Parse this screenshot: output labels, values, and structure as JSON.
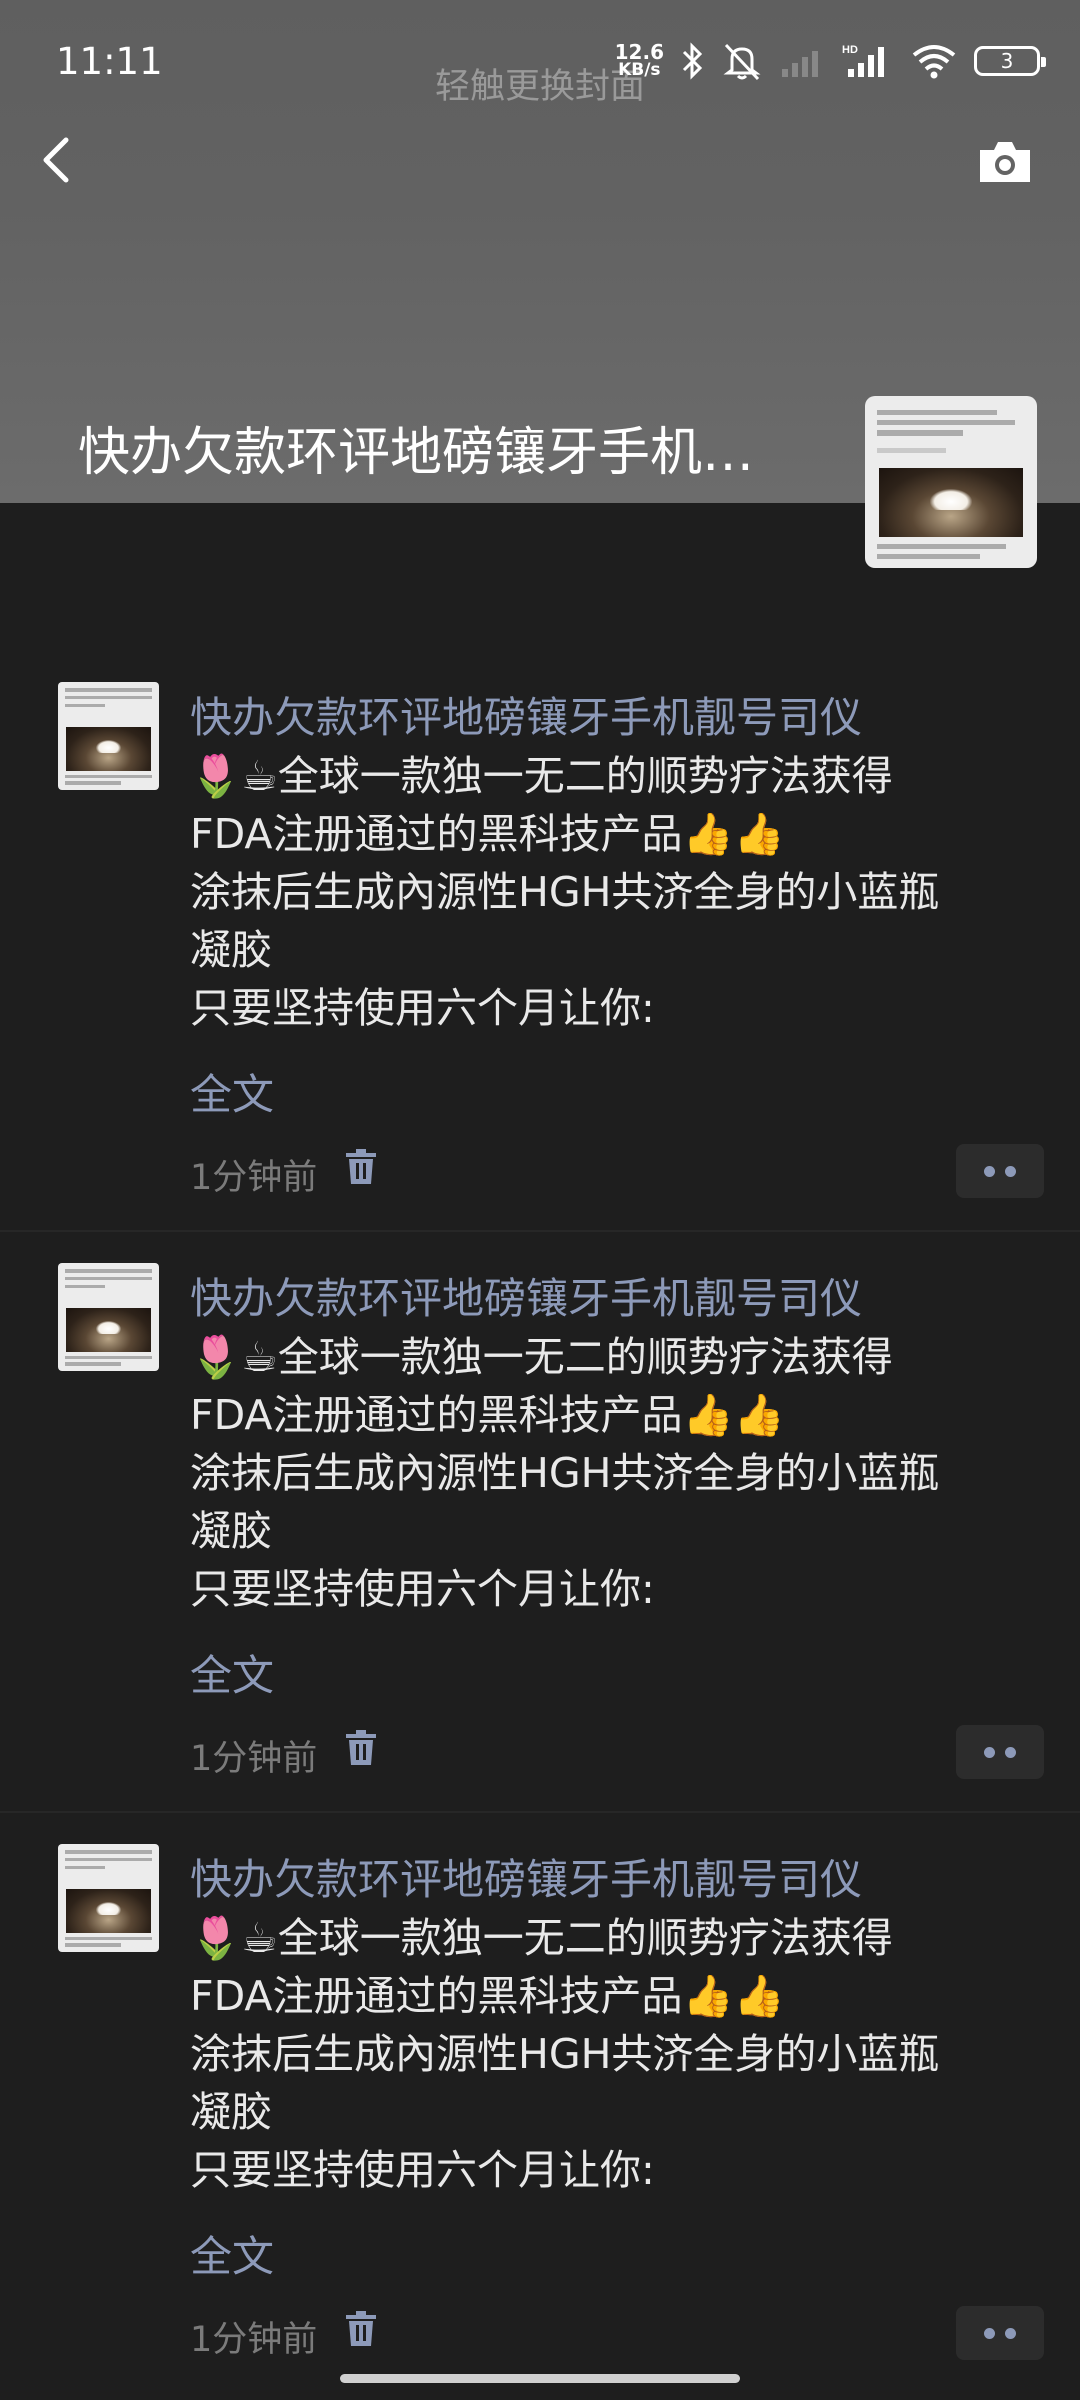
{
  "status_bar": {
    "time": "11:11",
    "net_speed_value": "12.6",
    "net_speed_unit": "KB/s",
    "battery": "3"
  },
  "cover": {
    "hint": "轻触更换封面",
    "title": "快办欠款环评地磅镶牙手机…"
  },
  "colors": {
    "background": "#1e1e1e",
    "cover": "#646464",
    "link": "#8d9ab9",
    "text": "#e9e9e9",
    "muted": "#7b7b7b"
  },
  "posts": [
    {
      "name": "快办欠款环评地磅镶牙手机靓号司仪",
      "lines": [
        "🌷☕全球一款独一无二的顺势疗法获得",
        "FDA注册通过的黑科技产品👍👍",
        "涂抹后生成內源性HGH共济全身的小蓝瓶",
        "凝胶",
        "只要坚持使用六个月让你:"
      ],
      "more": "全文",
      "time": "1分钟前"
    },
    {
      "name": "快办欠款环评地磅镶牙手机靓号司仪",
      "lines": [
        "🌷☕全球一款独一无二的顺势疗法获得",
        "FDA注册通过的黑科技产品👍👍",
        "涂抹后生成內源性HGH共济全身的小蓝瓶",
        "凝胶",
        "只要坚持使用六个月让你:"
      ],
      "more": "全文",
      "time": "1分钟前"
    },
    {
      "name": "快办欠款环评地磅镶牙手机靓号司仪",
      "lines": [
        "🌷☕全球一款独一无二的顺势疗法获得",
        "FDA注册通过的黑科技产品👍👍",
        "涂抹后生成內源性HGH共济全身的小蓝瓶",
        "凝胶",
        "只要坚持使用六个月让你:"
      ],
      "more": "全文",
      "time": "1分钟前"
    }
  ]
}
